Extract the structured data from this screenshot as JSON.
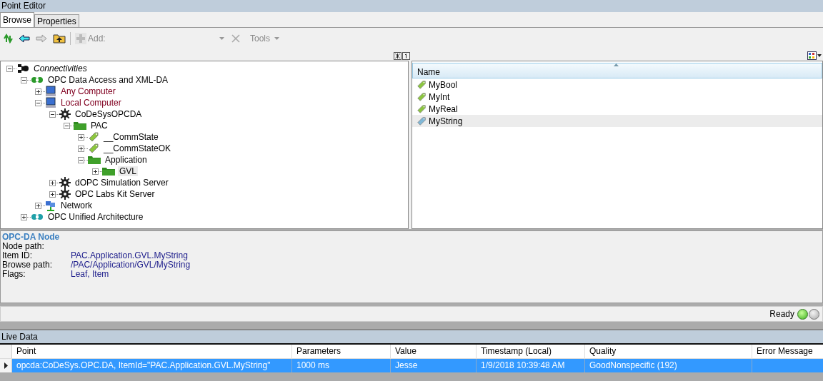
{
  "window": {
    "title": "Point Editor"
  },
  "tabs": [
    {
      "label": "Browse",
      "selected": true
    },
    {
      "label": "Properties",
      "selected": false
    }
  ],
  "toolbar": {
    "items": [
      {
        "kind": "refresh",
        "disabled": false
      },
      {
        "kind": "back",
        "disabled": false
      },
      {
        "kind": "forward",
        "disabled": true
      },
      {
        "kind": "up",
        "disabled": false
      },
      {
        "kind": "add",
        "disabled": true,
        "label": "Add:"
      },
      {
        "kind": "delete",
        "disabled": true
      },
      {
        "kind": "menu",
        "disabled": true,
        "label": "Tools"
      }
    ]
  },
  "tree": [
    {
      "label": "Connectivities",
      "kind": "root",
      "expanded": true,
      "selected": false,
      "children": [
        {
          "label": "OPC Data Access and XML-DA",
          "kind": "protocol",
          "expanded": true,
          "selected": false,
          "children": [
            {
              "label": "Any Computer",
              "kind": "computer",
              "expanded": false,
              "selected": false
            },
            {
              "label": "Local Computer",
              "kind": "computer",
              "expanded": true,
              "selected": false,
              "children": [
                {
                  "label": "CoDeSysOPCDA",
                  "kind": "server",
                  "expanded": true,
                  "selected": false,
                  "children": [
                    {
                      "label": "PAC",
                      "kind": "folder",
                      "expanded": true,
                      "selected": false,
                      "children": [
                        {
                          "label": "__CommState",
                          "kind": "tag",
                          "expanded": false,
                          "selected": false
                        },
                        {
                          "label": "__CommStateOK",
                          "kind": "tag",
                          "expanded": false,
                          "selected": false
                        },
                        {
                          "label": "Application",
                          "kind": "folder",
                          "expanded": true,
                          "selected": false,
                          "children": [
                            {
                              "label": "GVL",
                              "kind": "folder",
                              "expanded": false,
                              "selected": true
                            }
                          ]
                        }
                      ]
                    }
                  ]
                },
                {
                  "label": "dOPC Simulation Server",
                  "kind": "server",
                  "expanded": false,
                  "selected": false
                },
                {
                  "label": "OPC Labs Kit Server",
                  "kind": "server",
                  "expanded": false,
                  "selected": false
                }
              ]
            },
            {
              "label": "Network",
              "kind": "network",
              "expanded": false,
              "selected": false
            }
          ]
        },
        {
          "label": "OPC Unified Architecture",
          "kind": "protocol2",
          "expanded": false,
          "selected": false
        }
      ]
    }
  ],
  "list": {
    "column": "Name",
    "items": [
      {
        "label": "MyBool",
        "selected": false
      },
      {
        "label": "MyInt",
        "selected": false
      },
      {
        "label": "MyReal",
        "selected": false
      },
      {
        "label": "MyString",
        "selected": true
      }
    ]
  },
  "details": {
    "heading": "OPC-DA Node",
    "fields": [
      {
        "label": "Node path:"
      },
      {
        "label": "Item ID:",
        "value": "PAC.Application.GVL.MyString"
      },
      {
        "label": "Browse path:",
        "value": "/PAC/Application/GVL/MyString"
      },
      {
        "label": "Flags:",
        "value": "Leaf, Item"
      }
    ]
  },
  "status": {
    "text": "Ready",
    "lights": [
      {
        "on": true
      },
      {
        "on": false
      }
    ]
  },
  "live_data": {
    "title": "Live Data",
    "columns": [
      "Point",
      "Parameters",
      "Value",
      "Timestamp (Local)",
      "Quality",
      "Error Message"
    ],
    "rows": [
      {
        "selected": true,
        "cells": [
          "opcda:CoDeSys.OPC.DA, ItemId=\"PAC.Application.GVL.MyString\"",
          "1000 ms",
          "Jesse",
          "1/9/2018 10:39:48 AM",
          "GoodNonspecific (192)",
          ""
        ]
      }
    ]
  }
}
